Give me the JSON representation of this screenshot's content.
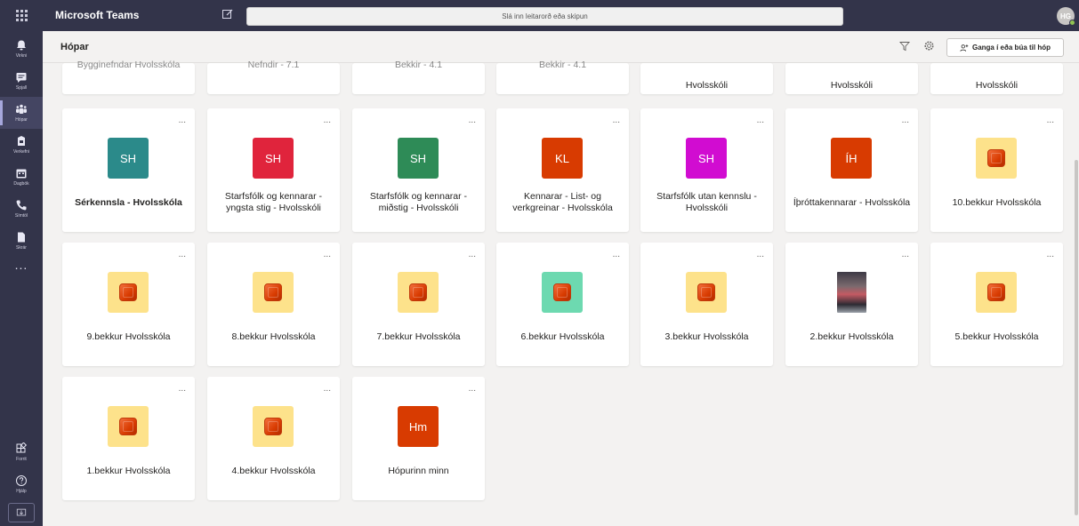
{
  "app": {
    "title": "Microsoft Teams",
    "search_placeholder": "Slá inn leitarorð eða skipun",
    "user_initials": "HG"
  },
  "rail": {
    "items": [
      {
        "label": "Virkni",
        "icon": "bell-icon"
      },
      {
        "label": "Spjall",
        "icon": "chat-icon"
      },
      {
        "label": "Hópar",
        "icon": "teams-icon"
      },
      {
        "label": "Verkefni",
        "icon": "assignments-icon"
      },
      {
        "label": "Dagbók",
        "icon": "calendar-icon"
      },
      {
        "label": "Símtöl",
        "icon": "phone-icon"
      },
      {
        "label": "Skrár",
        "icon": "files-icon"
      }
    ],
    "more": "...",
    "bottom": [
      {
        "label": "Forrit",
        "icon": "apps-icon"
      },
      {
        "label": "Hjálp",
        "icon": "help-icon"
      }
    ]
  },
  "header": {
    "title": "Hópar",
    "join_button": "Ganga í eða búa til hóp"
  },
  "colors": {
    "rail_bg": "#33344a",
    "teal": "#2b8a8a",
    "red_pink": "#e0243c",
    "green": "#2e8b57",
    "orange_red": "#d83b01",
    "magenta": "#d10cd1",
    "office_tile_bg": "#fde28b",
    "office_tile_green_bg": "#6dd9b0"
  },
  "partial_row": [
    {
      "name": "Bygginefndar Hvolsskóla"
    },
    {
      "name": "Nefndir - 7.1"
    },
    {
      "name": "Bekkir - 4.1"
    },
    {
      "name": "Bekkir - 4.1"
    },
    {
      "name": "Hvolsskóli"
    },
    {
      "name": "Hvolsskóli"
    },
    {
      "name": "Hvolsskóli"
    }
  ],
  "row1": [
    {
      "initials": "SH",
      "color": "#2b8a8a",
      "name": "Sérkennsla - Hvolsskóla",
      "bold": true
    },
    {
      "initials": "SH",
      "color": "#e0243c",
      "name": "Starfsfólk og kennarar - yngsta stig - Hvolsskóli"
    },
    {
      "initials": "SH",
      "color": "#2e8b57",
      "name": "Starfsfólk og kennarar - miðstig - Hvolsskóli"
    },
    {
      "initials": "KL",
      "color": "#d83b01",
      "name": "Kennarar - List- og verkgreinar - Hvolsskóla"
    },
    {
      "initials": "SH",
      "color": "#d10cd1",
      "name": "Starfsfólk utan kennslu - Hvolsskóli"
    },
    {
      "initials": "ÍH",
      "color": "#d83b01",
      "name": "Íþróttakennarar - Hvolsskóla"
    },
    {
      "initials": "",
      "color": "#fde28b",
      "name": "10.bekkur Hvolsskóla"
    }
  ],
  "row2": [
    {
      "name": "9.bekkur Hvolsskóla",
      "color": "#fde28b"
    },
    {
      "name": "8.bekkur Hvolsskóla",
      "color": "#fde28b"
    },
    {
      "name": "7.bekkur Hvolsskóla",
      "color": "#fde28b"
    },
    {
      "name": "6.bekkur Hvolsskóla",
      "color": "#6dd9b0"
    },
    {
      "name": "3.bekkur Hvolsskóla",
      "color": "#fde28b"
    },
    {
      "name": "2.bekkur Hvolsskóla",
      "color": "photo"
    },
    {
      "name": "5.bekkur Hvolsskóla",
      "color": "#fde28b"
    }
  ],
  "row3": [
    {
      "name": "1.bekkur Hvolsskóla",
      "color": "#fde28b"
    },
    {
      "name": "4.bekkur Hvolsskóla",
      "color": "#fde28b"
    },
    {
      "name": "Hópurinn minn",
      "initials": "Hm",
      "color": "#d83b01"
    }
  ],
  "more_label": "..."
}
